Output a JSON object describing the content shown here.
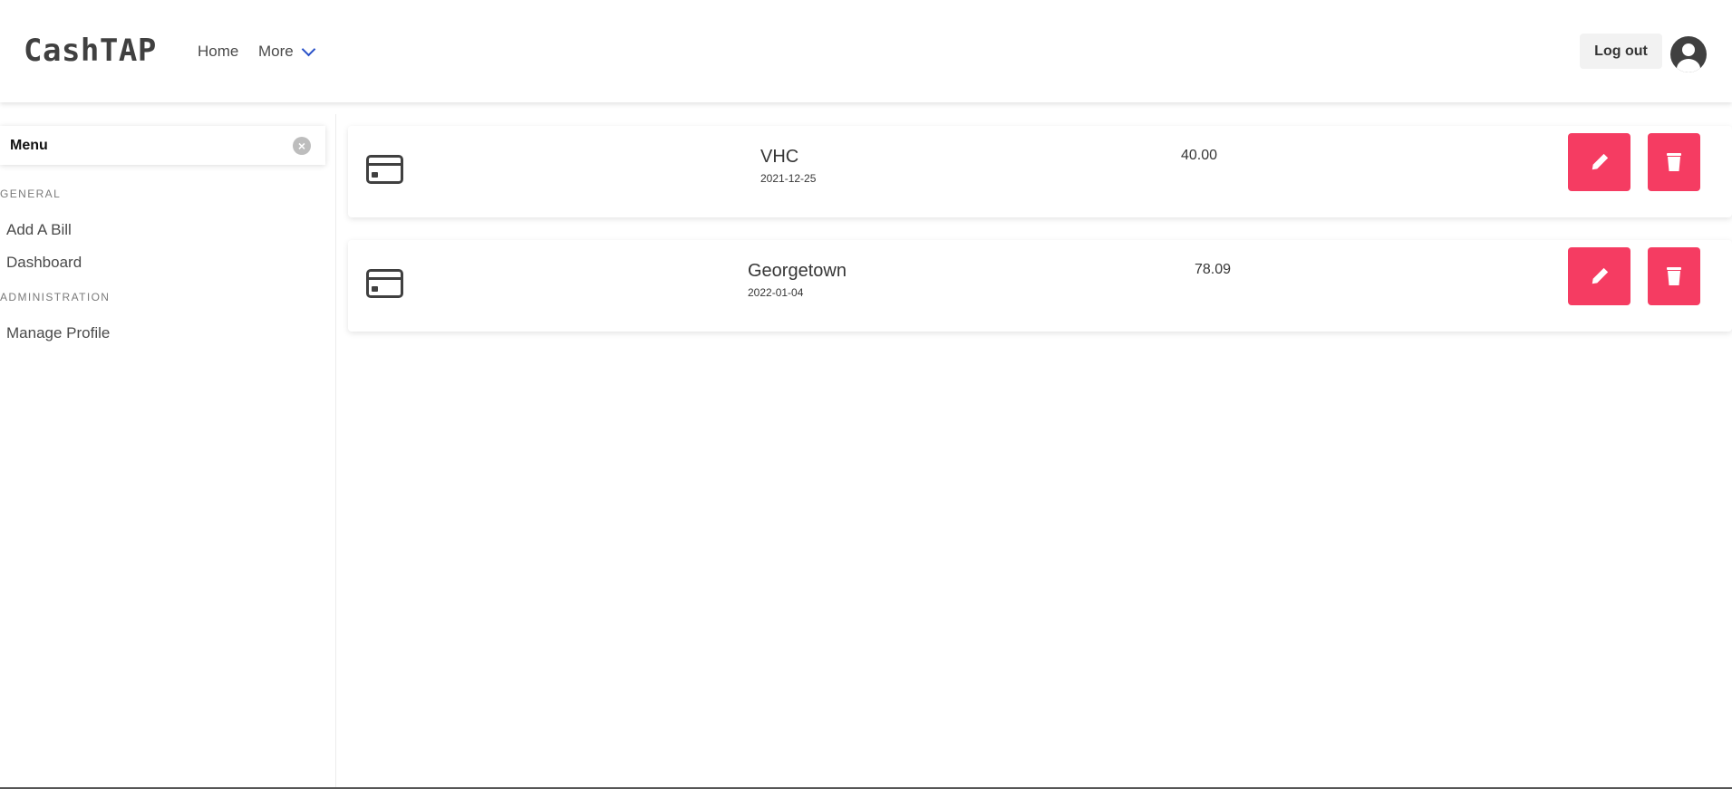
{
  "brand": "CashTAP",
  "nav": {
    "home": "Home",
    "more": "More"
  },
  "header": {
    "logout": "Log out"
  },
  "sidebar": {
    "title": "Menu",
    "close_symbol": "×",
    "sections": [
      {
        "label": "GENERAL",
        "items": [
          "Add A Bill",
          "Dashboard"
        ]
      },
      {
        "label": "ADMINISTRATION",
        "items": [
          "Manage Profile"
        ]
      }
    ]
  },
  "bills": [
    {
      "name": "VHC",
      "date": "2021-12-25",
      "amount": "40.00"
    },
    {
      "name": "Georgetown",
      "date": "2022-01-04",
      "amount": "78.09"
    }
  ],
  "icons": {
    "card": "credit-card-icon",
    "edit": "pencil-icon",
    "delete": "trash-icon",
    "avatar": "user-circle-icon",
    "more": "chevron-down-icon"
  },
  "colors": {
    "accent": "#f53c62",
    "link": "#2850c8"
  }
}
